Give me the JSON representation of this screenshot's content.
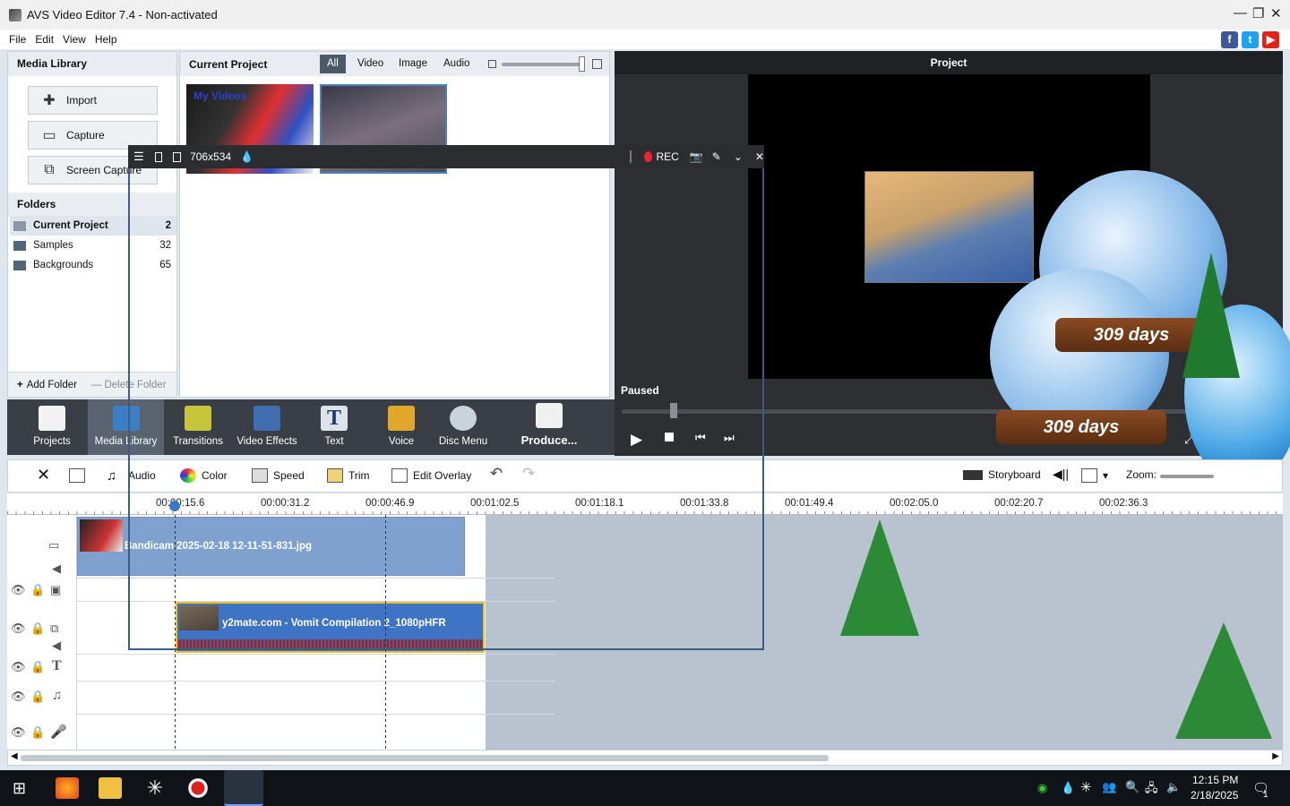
{
  "window": {
    "title": "AVS Video Editor 7.4 - Non-activated"
  },
  "menu": [
    "File",
    "Edit",
    "View",
    "Help"
  ],
  "social": [
    "f",
    "t",
    "▶"
  ],
  "media_library": {
    "title": "Media Library",
    "buttons": [
      "Import",
      "Capture",
      "Screen Capture"
    ],
    "folders_title": "Folders",
    "folders": [
      {
        "name": "Current Project",
        "count": "2"
      },
      {
        "name": "Samples",
        "count": "32"
      },
      {
        "name": "Backgrounds",
        "count": "65"
      }
    ],
    "add_folder": "Add Folder",
    "delete_folder": "Delete Folder"
  },
  "current_project": {
    "title": "Current Project",
    "filter_tabs": [
      "All",
      "Video",
      "Image",
      "Audio"
    ],
    "thumb1_text": "My Videos"
  },
  "preview": {
    "title": "Project",
    "status": "Paused"
  },
  "toolbar": [
    "Projects",
    "Media Library",
    "Transitions",
    "Video Effects",
    "Text",
    "Voice",
    "Disc Menu",
    "Produce..."
  ],
  "edit_toolbar": {
    "audio": "Audio",
    "color": "Color",
    "speed": "Speed",
    "trim": "Trim",
    "edit_overlay": "Edit Overlay",
    "storyboard": "Storyboard",
    "zoom": "Zoom:"
  },
  "ruler": [
    "00:00:15.6",
    "00:00:31.2",
    "00:00:46.9",
    "00:01:02.5",
    "00:01:18.1",
    "00:01:33.8",
    "00:01:49.4",
    "00:02:05.0",
    "00:02:20.7",
    "00:02:36.3"
  ],
  "clips": {
    "image_clip": "Bandicam 2025-02-18 12-11-51-831.jpg",
    "video_clip": "y2mate.com - Vomit Compilation 2_1080pHFR"
  },
  "recorder": {
    "size": "706x534",
    "rec_label": "REC"
  },
  "overlay": {
    "days_text": "309 days"
  },
  "taskbar": {
    "time": "12:15 PM",
    "date": "2/18/2025",
    "notification_count": "1"
  }
}
